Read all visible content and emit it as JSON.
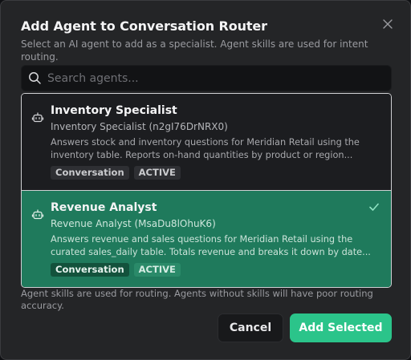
{
  "dialog": {
    "title": "Add Agent to Conversation Router",
    "subtitle": "Select an AI agent to add as a specialist. Agent skills are used for intent routing.",
    "close_icon": "close-icon"
  },
  "search": {
    "placeholder": "Search agents...",
    "value": "",
    "icon": "search-icon"
  },
  "agents": [
    {
      "name": "Inventory Specialist",
      "id_line": "Inventory Specialist (n2gI76DrNRX0)",
      "description": "Answers stock and inventory questions for Meridian Retail using the inventory table. Reports on-hand quantities by product or region...",
      "type": "Conversation",
      "status": "ACTIVE",
      "selected": false,
      "icon": "bot-icon"
    },
    {
      "name": "Revenue Analyst",
      "id_line": "Revenue Analyst (MsaDu8lOhuK6)",
      "description": "Answers revenue and sales questions for Meridian Retail using the curated sales_daily table. Totals revenue and breaks it down by date...",
      "type": "Conversation",
      "status": "ACTIVE",
      "selected": true,
      "icon": "bot-icon"
    }
  ],
  "footer": {
    "note": "Agent skills are used for routing. Agents without skills will have poor routing accuracy.",
    "cancel_label": "Cancel",
    "add_label": "Add Selected"
  },
  "colors": {
    "accent": "#2bc48a",
    "selected_row": "#1f7a5c",
    "background": "#242527"
  }
}
